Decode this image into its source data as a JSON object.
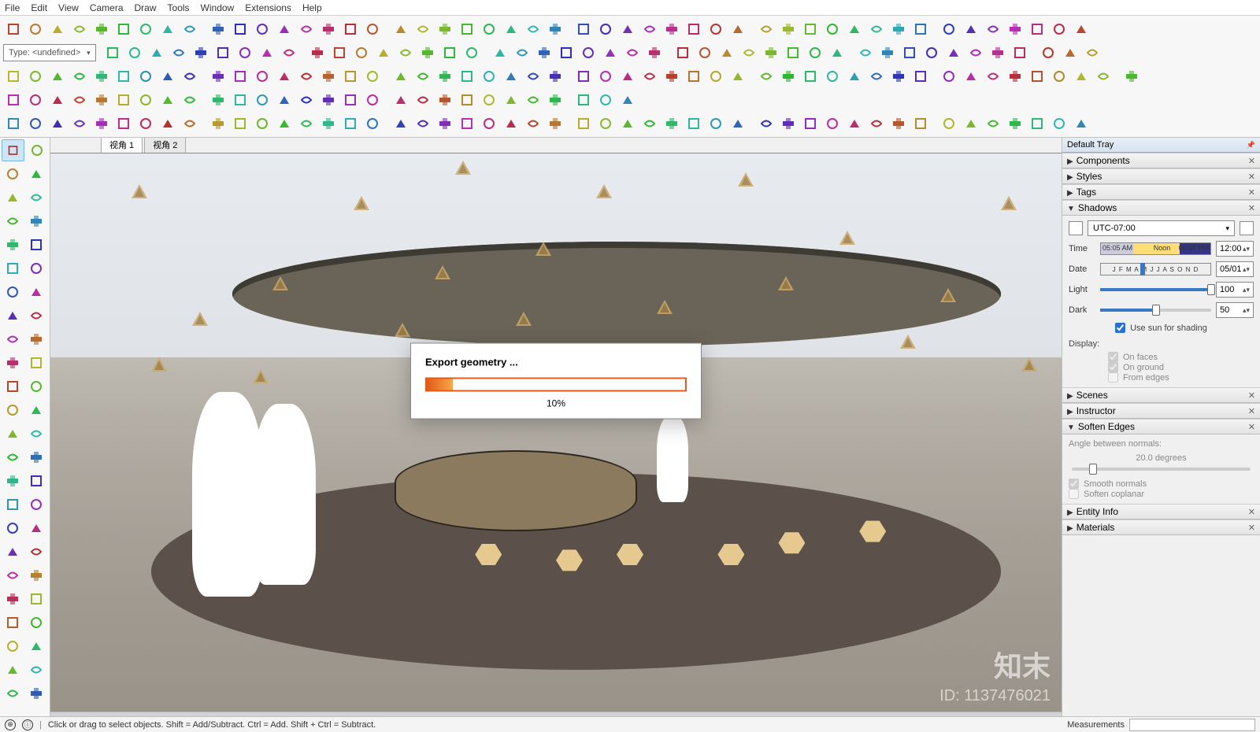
{
  "menu": [
    "File",
    "Edit",
    "View",
    "Camera",
    "Draw",
    "Tools",
    "Window",
    "Extensions",
    "Help"
  ],
  "type_selector": "Type: <undefined>",
  "scene_tabs": [
    {
      "label": "视角 1",
      "active": true
    },
    {
      "label": "视角 2",
      "active": false
    }
  ],
  "dialog": {
    "title": "Export geometry ...",
    "percent_label": "10%",
    "percent_value": 10
  },
  "tray": {
    "title": "Default Tray",
    "panels": {
      "components": "Components",
      "styles": "Styles",
      "tags": "Tags",
      "shadows": "Shadows",
      "scenes": "Scenes",
      "instructor": "Instructor",
      "soften": "Soften Edges",
      "entity": "Entity Info",
      "materials": "Materials"
    },
    "shadows": {
      "tz": "UTC-07:00",
      "time_label": "Time",
      "time_start": "05:05 AM",
      "time_noon": "Noon",
      "time_end": "06:51 PM",
      "time_value": "12:00",
      "date_label": "Date",
      "date_letters": "J F M A M J J A S O N D",
      "date_value": "05/01",
      "light_label": "Light",
      "light_value": "100",
      "dark_label": "Dark",
      "dark_value": "50",
      "sun_cb": "Use sun for shading",
      "display_label": "Display:",
      "on_faces": "On faces",
      "on_ground": "On ground",
      "from_edges": "From edges"
    },
    "soften": {
      "angle_label": "Angle between normals:",
      "angle_value": "20.0",
      "angle_unit": "degrees",
      "smooth": "Smooth normals",
      "coplanar": "Soften coplanar"
    }
  },
  "status": {
    "hint": "Click or drag to select objects. Shift = Add/Subtract. Ctrl = Add. Shift + Ctrl = Subtract.",
    "measurements": "Measurements"
  },
  "watermark": {
    "brand": "知末",
    "id": "ID: 1137476021"
  }
}
